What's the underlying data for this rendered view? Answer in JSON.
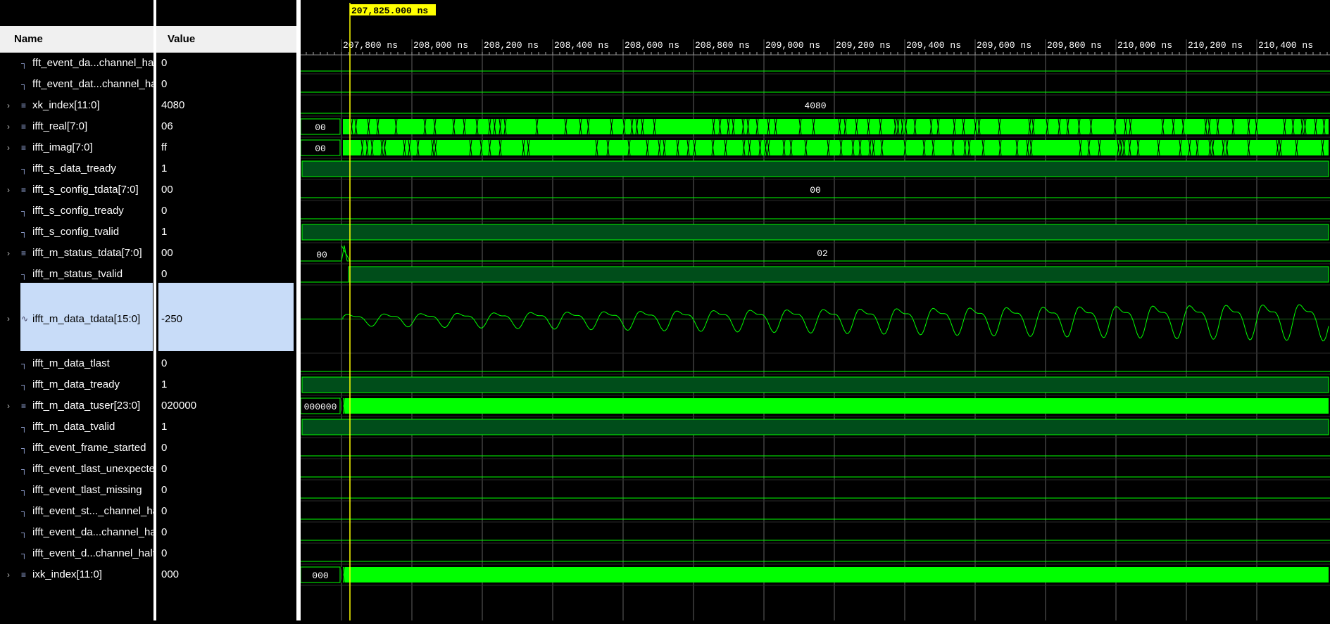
{
  "colors": {
    "wave": "#00ff00",
    "bus_fill": "#00ff00",
    "high_fill": "#004d1a",
    "grid": "#5f5f5f",
    "cursor": "#ffff00",
    "selection": "#c8dcf8"
  },
  "header": {
    "name_label": "Name",
    "value_label": "Value"
  },
  "cursor": {
    "label": "207,825.000 ns"
  },
  "timeline": {
    "ticks": [
      "207,800 ns",
      "208,000 ns",
      "208,200 ns",
      "208,400 ns",
      "208,600 ns",
      "208,800 ns",
      "209,000 ns",
      "209,200 ns",
      "209,400 ns",
      "209,600 ns",
      "209,800 ns",
      "210,000 ns",
      "210,200 ns",
      "210,400 ns"
    ]
  },
  "signals": [
    {
      "name": "fft_event_da...channel_halt",
      "value": "0",
      "kind": "bit",
      "icon": "bit-signal-icon"
    },
    {
      "name": "fft_event_dat...channel_halt",
      "value": "0",
      "kind": "bit",
      "icon": "bit-signal-icon"
    },
    {
      "name": "xk_index[11:0]",
      "value": "4080",
      "kind": "bus",
      "icon": "bus-signal-icon",
      "wave_label": "4080"
    },
    {
      "name": "ifft_real[7:0]",
      "value": "06",
      "kind": "bus",
      "icon": "bus-signal-icon",
      "wave_label": "00"
    },
    {
      "name": "ifft_imag[7:0]",
      "value": "ff",
      "kind": "bus",
      "icon": "bus-signal-icon",
      "wave_label": "00"
    },
    {
      "name": "ifft_s_data_tready",
      "value": "1",
      "kind": "bit",
      "icon": "bit-signal-icon"
    },
    {
      "name": "ifft_s_config_tdata[7:0]",
      "value": "00",
      "kind": "bus",
      "icon": "bus-signal-icon",
      "wave_label": "00"
    },
    {
      "name": "ifft_s_config_tready",
      "value": "0",
      "kind": "bit",
      "icon": "bit-signal-icon"
    },
    {
      "name": "ifft_s_config_tvalid",
      "value": "1",
      "kind": "bit",
      "icon": "bit-signal-icon"
    },
    {
      "name": "ifft_m_status_tdata[7:0]",
      "value": "00",
      "kind": "bus",
      "icon": "bus-signal-icon",
      "wave_label": "00",
      "wave_label2": "02"
    },
    {
      "name": "ifft_m_status_tvalid",
      "value": "0",
      "kind": "bit",
      "icon": "bit-signal-icon"
    },
    {
      "name": "ifft_m_data_tdata[15:0]",
      "value": "-250",
      "kind": "analog",
      "icon": "analog-signal-icon"
    },
    {
      "name": "ifft_m_data_tlast",
      "value": "0",
      "kind": "bit",
      "icon": "bit-signal-icon"
    },
    {
      "name": "ifft_m_data_tready",
      "value": "1",
      "kind": "bit",
      "icon": "bit-signal-icon"
    },
    {
      "name": "ifft_m_data_tuser[23:0]",
      "value": "020000",
      "kind": "bus",
      "icon": "bus-signal-icon",
      "wave_label": "000000"
    },
    {
      "name": "ifft_m_data_tvalid",
      "value": "1",
      "kind": "bit",
      "icon": "bit-signal-icon"
    },
    {
      "name": "ifft_event_frame_started",
      "value": "0",
      "kind": "bit",
      "icon": "bit-signal-icon"
    },
    {
      "name": "ifft_event_tlast_unexpected",
      "value": "0",
      "kind": "bit",
      "icon": "bit-signal-icon"
    },
    {
      "name": "ifft_event_tlast_missing",
      "value": "0",
      "kind": "bit",
      "icon": "bit-signal-icon"
    },
    {
      "name": "ifft_event_st..._channel_halt",
      "value": "0",
      "kind": "bit",
      "icon": "bit-signal-icon"
    },
    {
      "name": "ifft_event_da...channel_halt",
      "value": "0",
      "kind": "bit",
      "icon": "bit-signal-icon"
    },
    {
      "name": "ifft_event_d...channel_halt",
      "value": "0",
      "kind": "bit",
      "icon": "bit-signal-icon"
    },
    {
      "name": "ixk_index[11:0]",
      "value": "000",
      "kind": "bus",
      "icon": "bus-signal-icon",
      "wave_label": "000"
    }
  ]
}
